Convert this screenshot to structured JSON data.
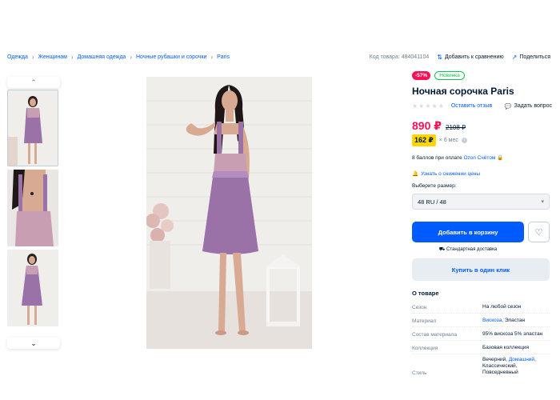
{
  "breadcrumbs": [
    "Одежда",
    "Женщинам",
    "Домашняя одежда",
    "Ночные рубашки и сорочки",
    "Paris"
  ],
  "topbar": {
    "product_code": "Код товара: 484041104",
    "compare": "Добавить к сравнению",
    "share": "Поделиться"
  },
  "badges": {
    "discount": "-57%",
    "new": "Новинка"
  },
  "product": {
    "title": "Ночная сорочка Paris",
    "stars": "★★★★★",
    "rating_value": 0,
    "leave_review": "Оставить отзыв",
    "ask_question": "Задать вопрос",
    "price": "890 ₽",
    "old_price": "2108 ₽",
    "installment_amount": "162 ₽",
    "installment_term": "× 6 мес",
    "info_glyph": "i",
    "points_text": "8 баллов при оплате",
    "points_link": "Ozon Счётом",
    "notify_price": "Узнать о снижении цены",
    "size_label": "Выберите размер:",
    "size_value": "48 RU / 48",
    "add_to_cart": "Добавить в корзину",
    "delivery": "Стандартная доставка",
    "buy_one_click": "Купить в один клик"
  },
  "about": {
    "title": "О товаре",
    "season_k": "Сезон",
    "season_v": "На любой сезон",
    "material_k": "Материал",
    "material_link": "Вискоза",
    "material_rest": ", Эластан",
    "composition_k": "Состав материала",
    "composition_v": "95% вискоза 5% эластан",
    "collection_k": "Коллекция",
    "collection_v": "Базовая коллекция",
    "style_k": "Стиль",
    "style_a": "Вечерний, ",
    "style_link": "Домашний",
    "style_b": ",",
    "style_c": "Классический,",
    "style_d": "Повседневный"
  },
  "colors": {
    "accent": "#005bff",
    "price": "#f91155",
    "new": "#10c44c",
    "installment": "#ffd600",
    "dress": "#9b72a8"
  },
  "icons": [
    "chevron-up-icon",
    "chevron-down-icon",
    "compare-icon",
    "share-icon",
    "question-icon",
    "bell-icon",
    "heart-icon",
    "truck-icon",
    "lock-icon",
    "info-icon"
  ]
}
